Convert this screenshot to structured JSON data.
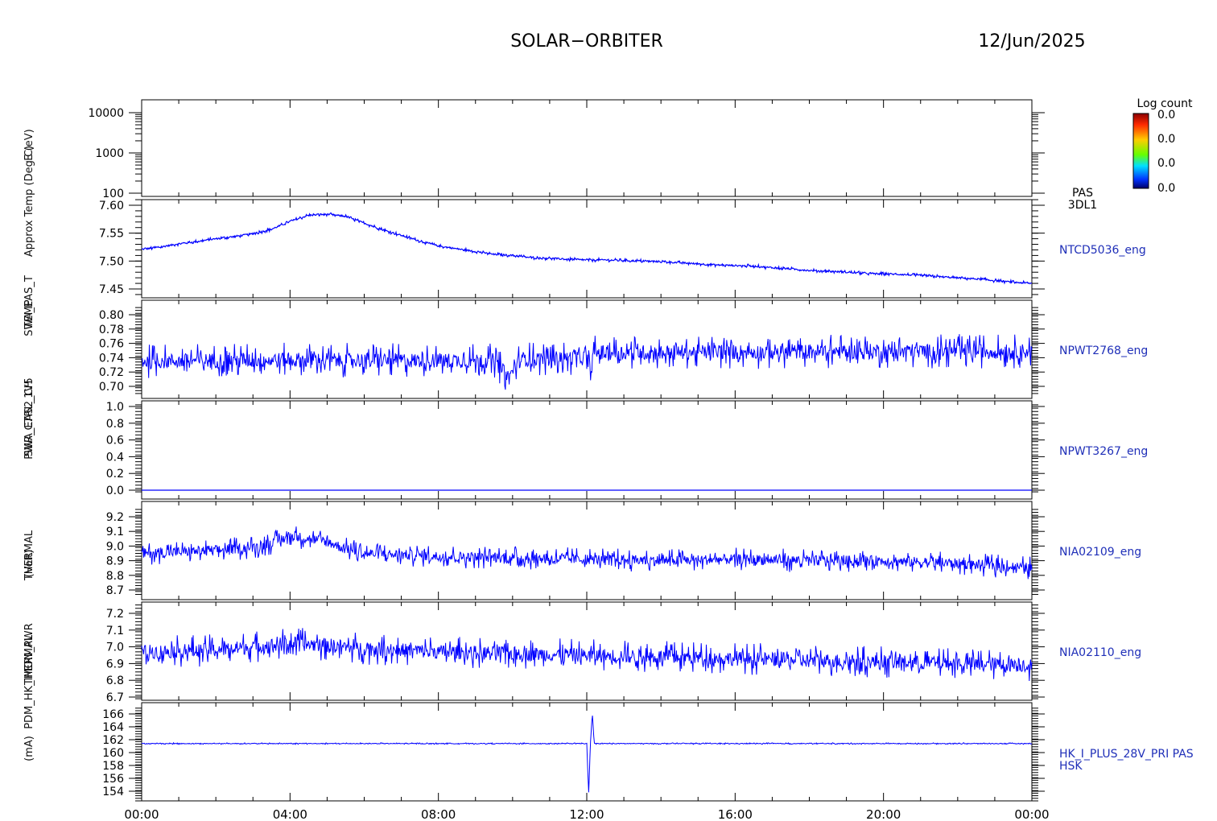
{
  "header": {
    "mission": "SOLAR−ORBITER",
    "date": "12/Jun/2025"
  },
  "colorbar": {
    "title": "Log count",
    "tick_labels": [
      "0.0",
      "0.0",
      "0.0",
      "0.0"
    ],
    "colors": [
      "#8b0000",
      "#ff2a00",
      "#ffcc00",
      "#66ff00",
      "#00e0ff",
      "#0033ff",
      "#000066"
    ]
  },
  "left_labels": [
    "Approx Temp (Deg C)",
    "E (eV)",
    "TEMP",
    "SWA_EAS_T",
    "PWR_CTRL_1V5",
    "SWA_EAS2_CH",
    "(mA)",
    "(Volt)",
    "THERMAL",
    "THERMAL",
    "PDM_HK_IMON_PWR"
  ],
  "colors": {
    "trace": "#0000ff",
    "right_label": "#1f2fb8",
    "axes": "#000000"
  },
  "chart_data": {
    "type": "line",
    "x_range": [
      "00:00",
      "00:00"
    ],
    "x_ticks": [
      "00:00",
      "04:00",
      "08:00",
      "12:00",
      "16:00",
      "20:00",
      "00:00"
    ],
    "panels": [
      {
        "id": "pas-3dl1",
        "type": "heatmap",
        "scale": "log",
        "ylim": [
          100,
          10000
        ],
        "yticks": [
          100,
          1000,
          10000
        ],
        "yticklabels": [
          "100",
          "1000",
          "10000"
        ],
        "right_label": [
          "PAS",
          "3DL1"
        ],
        "series": []
      },
      {
        "id": "ntcd5036",
        "ylim": [
          7.44,
          7.61
        ],
        "yticks": [
          7.45,
          7.5,
          7.55,
          7.6
        ],
        "yticklabels": [
          "7.45",
          "7.50",
          "7.55",
          "7.60"
        ],
        "right_label": [
          "NTCD5036_eng"
        ],
        "series": [
          {
            "x": [
              0,
              0.5,
              1,
              1.5,
              2,
              2.5,
              3,
              3.5,
              4,
              4.5,
              5,
              5.5,
              6,
              6.5,
              7,
              7.5,
              8,
              8.5,
              9,
              9.5,
              10,
              10.5,
              11,
              11.5,
              12,
              12.5,
              13,
              13.5,
              14,
              14.5,
              15,
              15.5,
              16,
              16.5,
              17,
              17.5,
              18,
              18.5,
              19,
              19.5,
              20,
              20.5,
              21,
              21.5,
              22,
              22.5,
              23,
              23.5,
              24
            ],
            "y": [
              7.521,
              7.525,
              7.531,
              7.535,
              7.54,
              7.544,
              7.549,
              7.557,
              7.571,
              7.582,
              7.584,
              7.58,
              7.568,
              7.556,
              7.546,
              7.536,
              7.527,
              7.522,
              7.517,
              7.512,
              7.51,
              7.506,
              7.505,
              7.503,
              7.502,
              7.502,
              7.501,
              7.5,
              7.499,
              7.497,
              7.495,
              7.493,
              7.492,
              7.491,
              7.488,
              7.486,
              7.483,
              7.482,
              7.48,
              7.478,
              7.477,
              7.476,
              7.474,
              7.472,
              7.47,
              7.468,
              7.465,
              7.462,
              7.46
            ],
            "noise": 0.004
          }
        ]
      },
      {
        "id": "npwt2768",
        "ylim": [
          0.69,
          0.81
        ],
        "yticks": [
          0.7,
          0.72,
          0.74,
          0.76,
          0.78,
          0.8
        ],
        "yticklabels": [
          "0.70",
          "0.72",
          "0.74",
          "0.76",
          "0.78",
          "0.80"
        ],
        "right_label": [
          "NPWT2768_eng"
        ],
        "series": [
          {
            "x": [
              0,
              4,
              8,
              9.5,
              9.9,
              10.2,
              12,
              12.1,
              12.2,
              12.3,
              16,
              20,
              24
            ],
            "y": [
              0.735,
              0.737,
              0.736,
              0.736,
              0.712,
              0.738,
              0.74,
              0.718,
              0.748,
              0.747,
              0.748,
              0.749,
              0.749
            ],
            "noise": 0.03
          }
        ]
      },
      {
        "id": "npwt3267",
        "ylim": [
          -0.02,
          1.02
        ],
        "yticks": [
          0.0,
          0.2,
          0.4,
          0.6,
          0.8,
          1.0
        ],
        "yticklabels": [
          "0.0",
          "0.2",
          "0.4",
          "0.6",
          "0.8",
          "1.0"
        ],
        "right_label": [
          "NPWT3267_eng"
        ],
        "series": [
          {
            "x": [
              0,
              24
            ],
            "y": [
              0.0,
              0.0
            ],
            "noise": 0.0
          }
        ]
      },
      {
        "id": "nia02109",
        "ylim": [
          8.67,
          9.25
        ],
        "yticks": [
          8.7,
          8.8,
          8.9,
          9.0,
          9.1,
          9.2
        ],
        "yticklabels": [
          "8.7",
          "8.8",
          "8.9",
          "9.0",
          "9.1",
          "9.2"
        ],
        "right_label": [
          "NIA02109_eng"
        ],
        "series": [
          {
            "x": [
              0,
              2,
              3,
              3.5,
              4,
              5,
              5.5,
              6,
              8,
              10,
              12,
              14,
              16,
              18,
              20,
              22,
              24
            ],
            "y": [
              8.95,
              8.97,
              8.99,
              9.02,
              9.07,
              9.03,
              8.98,
              8.95,
              8.93,
              8.92,
              8.91,
              8.9,
              8.91,
              8.9,
              8.9,
              8.88,
              8.85
            ],
            "noise": 0.1
          }
        ]
      },
      {
        "id": "nia02110",
        "ylim": [
          6.65,
          7.25
        ],
        "yticks": [
          6.7,
          6.8,
          6.9,
          7.0,
          7.1,
          7.2
        ],
        "yticklabels": [
          "6.7",
          "6.8",
          "6.9",
          "7.0",
          "7.1",
          "7.2"
        ],
        "right_label": [
          "NIA02110_eng"
        ],
        "series": [
          {
            "x": [
              0,
              2,
              3,
              4,
              5,
              6,
              8,
              10,
              12,
              14,
              16,
              18,
              20,
              22,
              24
            ],
            "y": [
              6.97,
              6.98,
              7.0,
              7.02,
              7.01,
              6.99,
              6.97,
              6.96,
              6.95,
              6.94,
              6.93,
              6.92,
              6.91,
              6.9,
              6.89
            ],
            "noise": 0.12
          }
        ]
      },
      {
        "id": "hk-i-plus-28v",
        "ylim": [
          152.5,
          167
        ],
        "yticks": [
          154,
          156,
          158,
          160,
          162,
          164,
          166
        ],
        "yticklabels": [
          "154",
          "156",
          "158",
          "160",
          "162",
          "164",
          "166"
        ],
        "right_label": [
          "HK_I_PLUS_28V_PRI PAS",
          "HSK"
        ],
        "series": [
          {
            "x": [
              0,
              12.0,
              12.05,
              12.1,
              12.15,
              12.2,
              24
            ],
            "y": [
              161.4,
              161.4,
              153.5,
              161.5,
              166.1,
              161.4,
              161.4
            ],
            "noise": 0.15
          }
        ]
      }
    ]
  }
}
